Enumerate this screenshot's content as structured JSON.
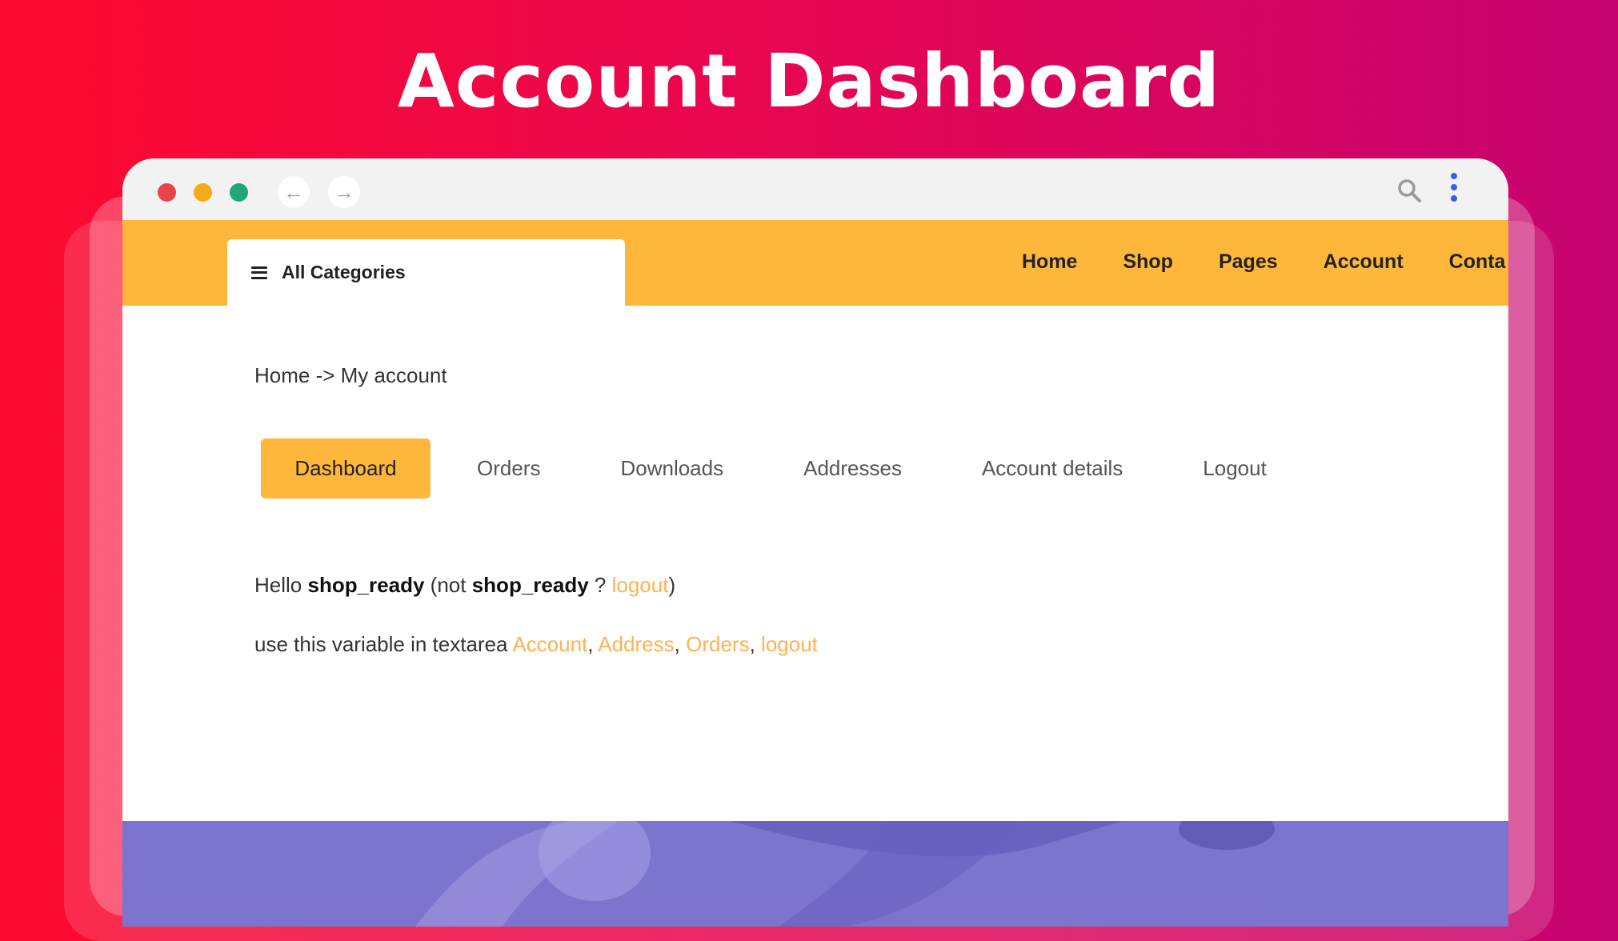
{
  "hero": {
    "title": "Account Dashboard"
  },
  "header": {
    "categories_label": "All Categories",
    "nav": [
      "Home",
      "Shop",
      "Pages",
      "Account",
      "Conta"
    ]
  },
  "breadcrumb": "Home -> My account",
  "tabs": [
    "Dashboard",
    "Orders",
    "Downloads",
    "Addresses",
    "Account details",
    "Logout"
  ],
  "greeting": {
    "hello": "Hello",
    "username": "shop_ready",
    "not_prefix": "(not",
    "not_username": "shop_ready",
    "question": "?",
    "logout_link": "logout",
    "close_paren": ")"
  },
  "hint": {
    "text": "use this variable in textarea",
    "links": [
      "Account",
      "Address",
      "Orders",
      "logout"
    ]
  },
  "colors": {
    "accent": "#feb73a",
    "link": "#feb252",
    "background_start": "#fd0a2e",
    "background_end": "#c60470"
  },
  "icons": {
    "search": "search-icon",
    "menu": "more-vertical-icon",
    "back": "arrow-left-icon",
    "forward": "arrow-right-icon",
    "hamburger": "hamburger-icon"
  }
}
